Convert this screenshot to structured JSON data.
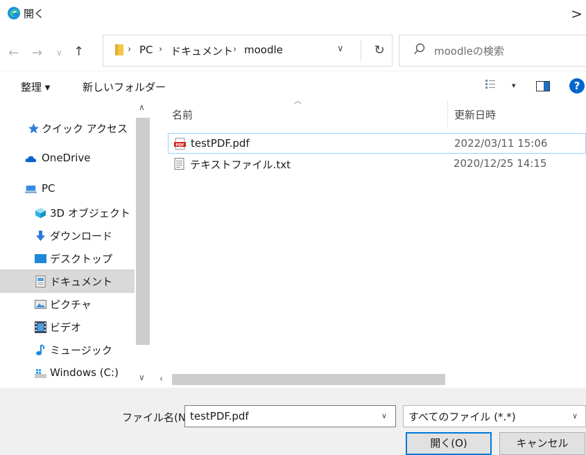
{
  "window": {
    "title": "開く",
    "close_glyph": ">"
  },
  "nav": {
    "breadcrumb": [
      "PC",
      "ドキュメント",
      "moodle"
    ],
    "search_placeholder": "moodleの検索"
  },
  "toolbar": {
    "organize_label": "整理 ▾",
    "new_folder_label": "新しいフォルダー"
  },
  "sidebar": {
    "items": [
      {
        "label": "クイック アクセス",
        "icon": "star-icon"
      },
      {
        "label": "OneDrive",
        "icon": "cloud-icon"
      },
      {
        "label": "PC",
        "icon": "computer-icon"
      },
      {
        "label": "3D オブジェクト",
        "icon": "cube-icon"
      },
      {
        "label": "ダウンロード",
        "icon": "download-icon"
      },
      {
        "label": "デスクトップ",
        "icon": "desktop-icon"
      },
      {
        "label": "ドキュメント",
        "icon": "document-icon",
        "selected": true
      },
      {
        "label": "ピクチャ",
        "icon": "pictures-icon"
      },
      {
        "label": "ビデオ",
        "icon": "video-icon"
      },
      {
        "label": "ミュージック",
        "icon": "music-icon"
      },
      {
        "label": "Windows (C:)",
        "icon": "drive-icon"
      }
    ]
  },
  "files": {
    "columns": {
      "name": "名前",
      "date": "更新日時"
    },
    "rows": [
      {
        "name": "testPDF.pdf",
        "date": "2022/03/11 15:06",
        "icon": "pdf-file-icon",
        "selected": true
      },
      {
        "name": "テキストファイル.txt",
        "date": "2020/12/25 14:15",
        "icon": "text-file-icon"
      }
    ]
  },
  "footer": {
    "filename_label": "ファイル名(N):",
    "filename_value": "testPDF.pdf",
    "filter_value": "すべてのファイル (*.*)",
    "open_label": "開く(O)",
    "cancel_label": "キャンセル"
  },
  "colors": {
    "accent": "#0078d7",
    "selected_row_border": "#99d1ff",
    "selected_nav_bg": "#d9d9d9"
  }
}
